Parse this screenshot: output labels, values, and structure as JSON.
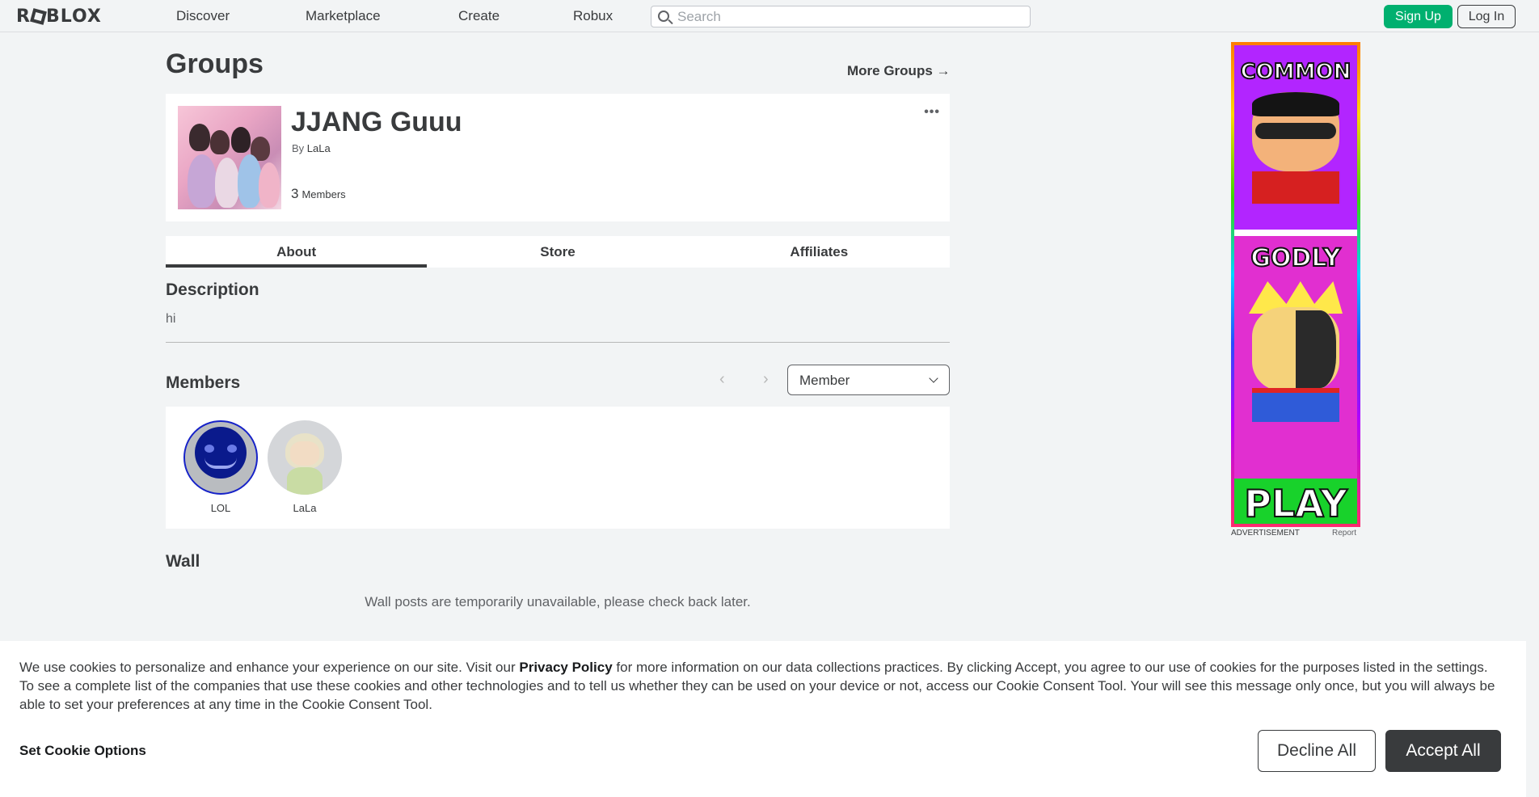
{
  "nav": {
    "logo": "ROBLOX",
    "links": [
      "Discover",
      "Marketplace",
      "Create",
      "Robux"
    ],
    "search_placeholder": "Search",
    "signup_label": "Sign Up",
    "login_label": "Log In"
  },
  "page": {
    "title": "Groups",
    "more_groups": "More Groups →"
  },
  "group": {
    "name": "JJANG Guuu",
    "by_prefix": "By",
    "owner": "LaLa",
    "member_count": "3",
    "member_label": "Members",
    "more_menu": "•••"
  },
  "tabs": [
    {
      "label": "About",
      "active": true
    },
    {
      "label": "Store",
      "active": false
    },
    {
      "label": "Affiliates",
      "active": false
    }
  ],
  "description": {
    "heading": "Description",
    "text": "hi"
  },
  "members": {
    "heading": "Members",
    "prev": "‹",
    "next": "›",
    "role_selected": "Member",
    "list": [
      {
        "name": "LOL"
      },
      {
        "name": "LaLa"
      }
    ]
  },
  "wall": {
    "heading": "Wall",
    "message": "Wall posts are temporarily unavailable, please check back later."
  },
  "ad": {
    "words": [
      "COMMON",
      "GODLY",
      "PLAY"
    ],
    "label": "ADVERTISEMENT",
    "report": "Report"
  },
  "cookie": {
    "text_before": "We use cookies to personalize and enhance your experience on our site. Visit our ",
    "link": "Privacy Policy",
    "text_after": " for more information on our data collections practices. By clicking Accept, you agree to our use of cookies for the purposes listed in the settings. To see a complete list of the companies that use these cookies and other technologies and to tell us whether they can be used on your device or not, access our Cookie Consent Tool. Your will see this message only once, but you will always be able to set your preferences at any time in the Cookie Consent Tool.",
    "set_options": "Set Cookie Options",
    "decline": "Decline All",
    "accept": "Accept All"
  },
  "colors": {
    "signup_green": "#00b06f",
    "text_dark": "#393b3d",
    "background": "#f2f4f5"
  }
}
